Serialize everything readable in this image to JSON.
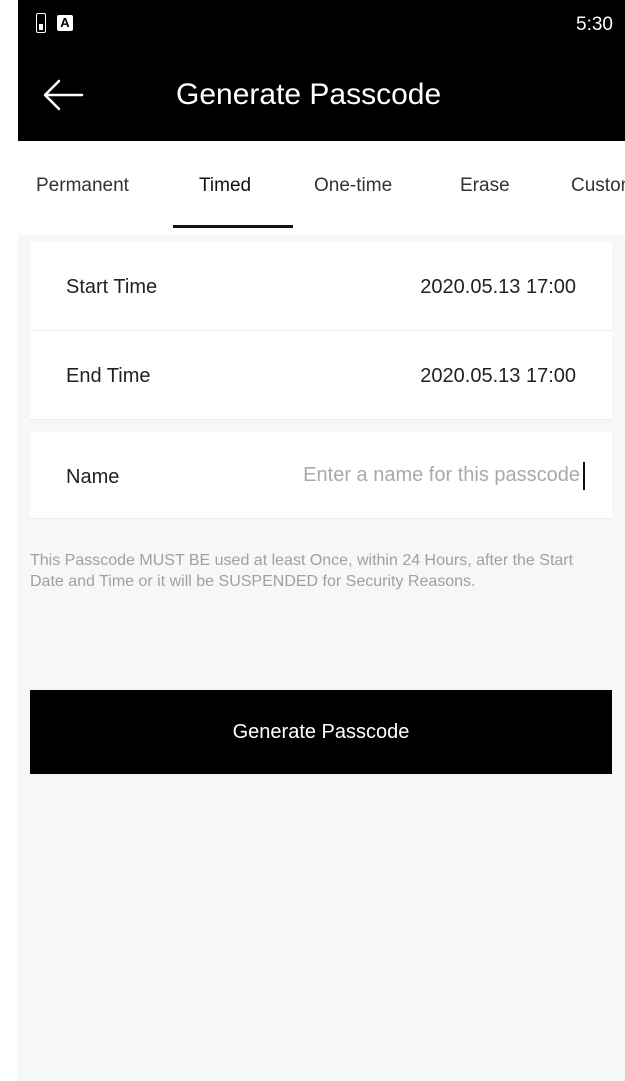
{
  "status_bar": {
    "time": "5:30",
    "icons": [
      "battery-icon",
      "a-notification-icon"
    ]
  },
  "app_bar": {
    "title": "Generate Passcode",
    "back_icon": "back-arrow-icon"
  },
  "tabs": [
    {
      "label": "Permanent",
      "active": false
    },
    {
      "label": "Timed",
      "active": true
    },
    {
      "label": "One-time",
      "active": false
    },
    {
      "label": "Erase",
      "active": false
    },
    {
      "label": "Custom",
      "active": false
    }
  ],
  "form": {
    "start_time": {
      "label": "Start Time",
      "value": "2020.05.13 17:00"
    },
    "end_time": {
      "label": "End Time",
      "value": "2020.05.13 17:00"
    },
    "name": {
      "label": "Name",
      "value": "",
      "placeholder": "Enter a name for this passcode"
    }
  },
  "notice": "This Passcode MUST BE used at least Once, within 24 Hours, after the Start Date and Time or it will be SUSPENDED for Security Reasons.",
  "generate_button": {
    "label": "Generate Passcode"
  },
  "colors": {
    "header": "#000000",
    "background": "#f7f7f7",
    "button": "#000000",
    "notice_text": "#a0a0a0"
  }
}
